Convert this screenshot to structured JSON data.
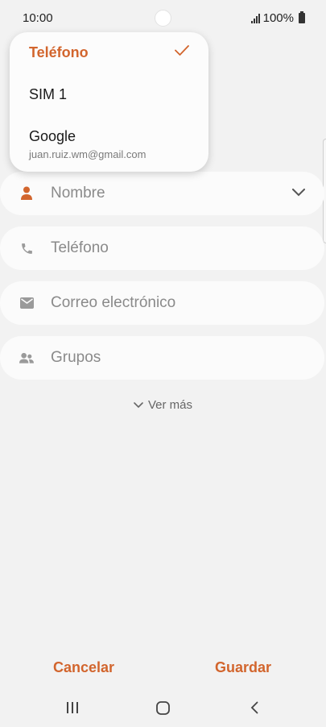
{
  "status_bar": {
    "time": "10:00",
    "battery": "100%"
  },
  "dropdown": {
    "selected_label": "Teléfono",
    "options": [
      {
        "label": "SIM 1"
      },
      {
        "label": "Google",
        "account": "juan.ruiz.wm@gmail.com"
      }
    ]
  },
  "form": {
    "fields": [
      {
        "label": "Nombre",
        "icon": "person-icon"
      },
      {
        "label": "Teléfono",
        "icon": "phone-icon"
      },
      {
        "label": "Correo electrónico",
        "icon": "email-icon"
      },
      {
        "label": "Grupos",
        "icon": "groups-icon"
      }
    ],
    "more_label": "Ver más"
  },
  "actions": {
    "cancel_label": "Cancelar",
    "save_label": "Guardar"
  },
  "colors": {
    "accent": "#d2652d",
    "background": "#f2f2f2",
    "field_bg": "#fbfbfb"
  }
}
